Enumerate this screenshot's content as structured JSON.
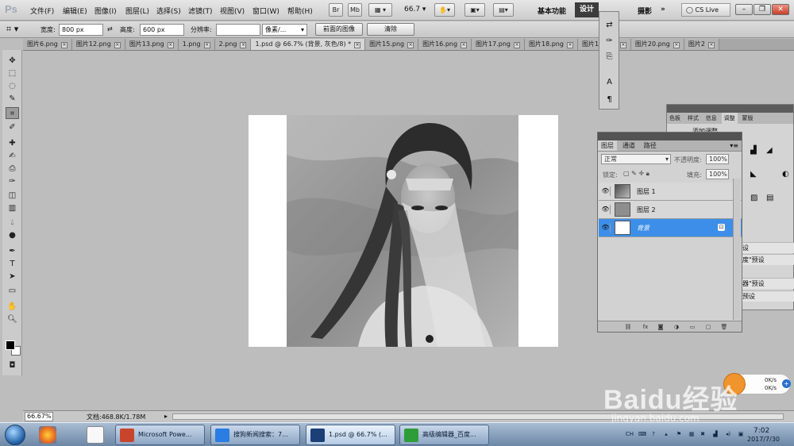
{
  "menubar": {
    "logo": "Ps",
    "items": [
      "文件(F)",
      "编辑(E)",
      "图像(I)",
      "图层(L)",
      "选择(S)",
      "滤镜(T)",
      "视图(V)",
      "窗口(W)",
      "帮助(H)"
    ],
    "bridge_btn": "Br",
    "minibridge_btn": "Mb",
    "zoom_value": "66.7",
    "workspace_basic": "基本功能",
    "workspace_design": "设计",
    "workspace_photo": "摄影",
    "more": "»",
    "cs_live": "CS Live"
  },
  "options": {
    "width_label": "宽度:",
    "width_value": "800 px",
    "height_label": "高度:",
    "height_value": "600 px",
    "resolution_label": "分辨率:",
    "resolution_value": "",
    "unit_value": "像素/...",
    "front_image_btn": "前面的图像",
    "clear_btn": "清除"
  },
  "tabs": [
    {
      "label": "图片6.png",
      "active": false
    },
    {
      "label": "图片12.png",
      "active": false
    },
    {
      "label": "图片13.png",
      "active": false
    },
    {
      "label": "1.png",
      "active": false
    },
    {
      "label": "2.png",
      "active": false
    },
    {
      "label": "1.psd @ 66.7% (背景, 灰色/8) *",
      "active": true
    },
    {
      "label": "图片15.png",
      "active": false
    },
    {
      "label": "图片16.png",
      "active": false
    },
    {
      "label": "图片17.png",
      "active": false
    },
    {
      "label": "图片18.png",
      "active": false
    },
    {
      "label": "图片19.png",
      "active": false
    },
    {
      "label": "图片20.png",
      "active": false
    },
    {
      "label": "图片2",
      "active": false
    }
  ],
  "adjustments_panel": {
    "tabs": [
      "色板",
      "样式",
      "信息",
      "调整",
      "蒙版"
    ],
    "title": "添加调整",
    "preset_rows": [
      "设",
      "度\"预设",
      "器\"预设",
      "预设"
    ]
  },
  "layers_panel": {
    "tabs": [
      "图层",
      "通道",
      "路径"
    ],
    "blend_mode": "正常",
    "opacity_label": "不透明度:",
    "opacity_value": "100%",
    "lock_label": "锁定:",
    "fill_label": "填充:",
    "fill_value": "100%",
    "layers": [
      {
        "name": "图层 1",
        "selected": false
      },
      {
        "name": "图层 2",
        "selected": false
      },
      {
        "name": "背景",
        "selected": true
      }
    ]
  },
  "status": {
    "zoom": "66.67%",
    "doc_size": "文档:468.8K/1.78M"
  },
  "taskbar": {
    "buttons": [
      {
        "label": "Microsoft Powe...",
        "icon": "powerpoint-icon",
        "color": "#c8452c",
        "active": false
      },
      {
        "label": "搜狗新闻搜索：7...",
        "icon": "sogou-browser-icon",
        "color": "#2a7de1",
        "active": false
      },
      {
        "label": "1.psd @ 66.7% (...",
        "icon": "photoshop-icon",
        "color": "#1b3f77",
        "active": true
      },
      {
        "label": "高级编辑器_百度...",
        "icon": "ie-browser-icon",
        "color": "#2f9c3a",
        "active": false
      }
    ],
    "tray_lang": "CH",
    "time": "7:02",
    "date": "2017/7/30"
  },
  "network_widget": {
    "upload": "0K/s",
    "download": "0K/s"
  },
  "watermark": {
    "brand": "Baidu经验",
    "url": "jingyan.baidu.com"
  },
  "icons": {
    "tools": [
      "move-icon",
      "marquee-icon",
      "lasso-icon",
      "quick-select-icon",
      "crop-icon",
      "eyedropper-icon",
      "healing-brush-icon",
      "brush-icon",
      "clone-stamp-icon",
      "history-brush-icon",
      "eraser-icon",
      "gradient-icon",
      "blur-icon",
      "dodge-icon",
      "pen-icon",
      "type-icon",
      "path-select-icon",
      "shape-icon",
      "hand-icon",
      "zoom-icon"
    ]
  }
}
